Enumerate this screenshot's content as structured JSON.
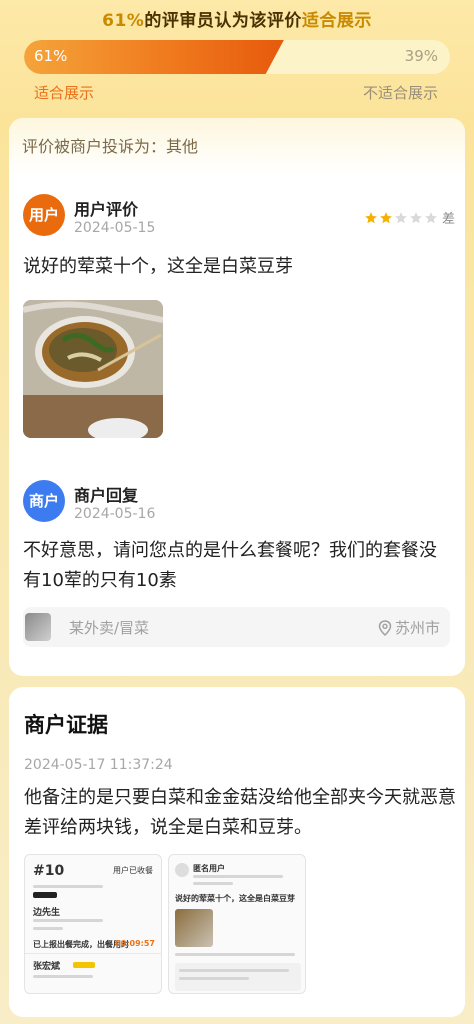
{
  "header": {
    "pct_text": "61%",
    "title_mid": "的评审员认为该评价",
    "title_highlight": "适合展示"
  },
  "progress": {
    "left_pct_label": "61%",
    "right_pct_label": "39%",
    "fill_fraction": 0.61,
    "left_label": "适合展示",
    "right_label": "不适合展示"
  },
  "complaint": {
    "label": "评价被商户投诉为：其他"
  },
  "user_review": {
    "avatar_text": "用户",
    "name": "用户评价",
    "date": "2024-05-15",
    "rating": 2,
    "rating_max": 5,
    "rating_word": "差",
    "content": "说好的荤菜十个，这全是白菜豆芽"
  },
  "merchant_reply": {
    "avatar_text": "商户",
    "name": "商户回复",
    "date": "2024-05-16",
    "content": "不好意思，请问您点的是什么套餐呢？我们的套餐没有10荤的只有10素"
  },
  "shop_bar": {
    "shop_name": "某外卖/冒菜",
    "city": "苏州市"
  },
  "evidence": {
    "title": "商户证据",
    "date": "2024-05-17 11:37:24",
    "text": "他备注的是只要白菜和金金菇没给他全部夹今天就恶意差评给两块钱，说全是白菜和豆芽。",
    "shot1": {
      "order_no": "#10",
      "status": "用户已收餐",
      "customer": "边先生",
      "notice": "已上报出餐完成，出餐用时",
      "timer": "00:09:57",
      "rider": "张宏斌"
    },
    "shot2": {
      "user": "匿名用户",
      "review": "说好的荤菜十个，这全是白菜豆芽"
    }
  },
  "colors": {
    "accent_orange": "#f07a1e",
    "user_avatar": "#ea6b0e",
    "merchant_avatar": "#3d7bf0",
    "star_on": "#f5b100",
    "star_off": "#d9d9d9"
  }
}
